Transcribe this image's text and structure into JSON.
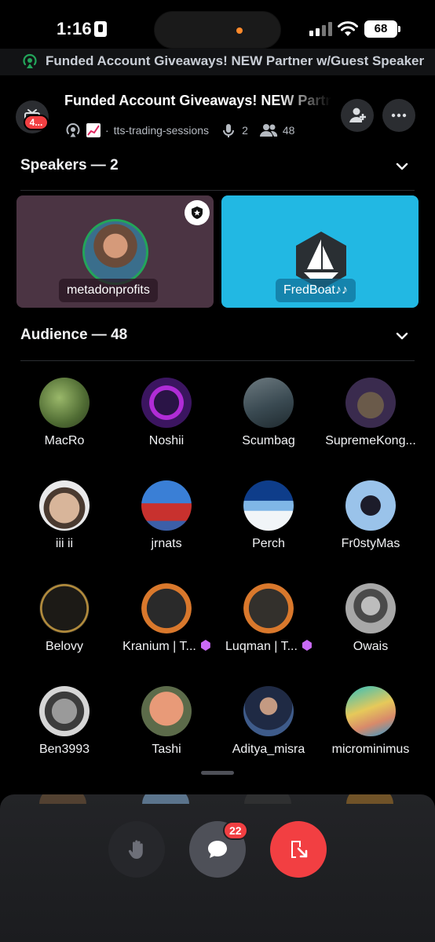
{
  "status_bar": {
    "time": "1:16",
    "battery": "68"
  },
  "live_banner": {
    "text": "Funded Account Giveaways! NEW Partner w/Guest Speaker"
  },
  "header": {
    "title": "Funded Account Giveaways! NEW Partner w/Guest Speaker",
    "tv_badge": "4...",
    "channel": "tts-trading-sessions",
    "speaker_count": "2",
    "listener_count": "48"
  },
  "speakers_section": {
    "label": "Speakers — 2",
    "speakers": [
      {
        "name": "metadonprofits"
      },
      {
        "name": "FredBoat♪♪"
      }
    ]
  },
  "audience_section": {
    "label": "Audience — 48",
    "members": [
      {
        "name": "MacRo"
      },
      {
        "name": "Noshii"
      },
      {
        "name": "Scumbag"
      },
      {
        "name": "SupremeKong..."
      },
      {
        "name": "iii ii"
      },
      {
        "name": "jrnats"
      },
      {
        "name": "Perch"
      },
      {
        "name": "Fr0styMas"
      },
      {
        "name": "Belovy"
      },
      {
        "name": "Kranium | T..."
      },
      {
        "name": "Luqman | T..."
      },
      {
        "name": "Owais"
      },
      {
        "name": "Ben3993"
      },
      {
        "name": "Tashi"
      },
      {
        "name": "Aditya_misra"
      },
      {
        "name": "microminimus"
      }
    ]
  },
  "controls": {
    "chat_badge": "22"
  },
  "colors": {
    "background": "#000000",
    "speaker_tile_1": "#4b3443",
    "speaker_tile_2": "#22b8e3",
    "speaking_ring": "#23a55a",
    "leave_button": "#f23f42",
    "notification_badge": "#f23f42",
    "boost_gem": "#c96af7"
  }
}
